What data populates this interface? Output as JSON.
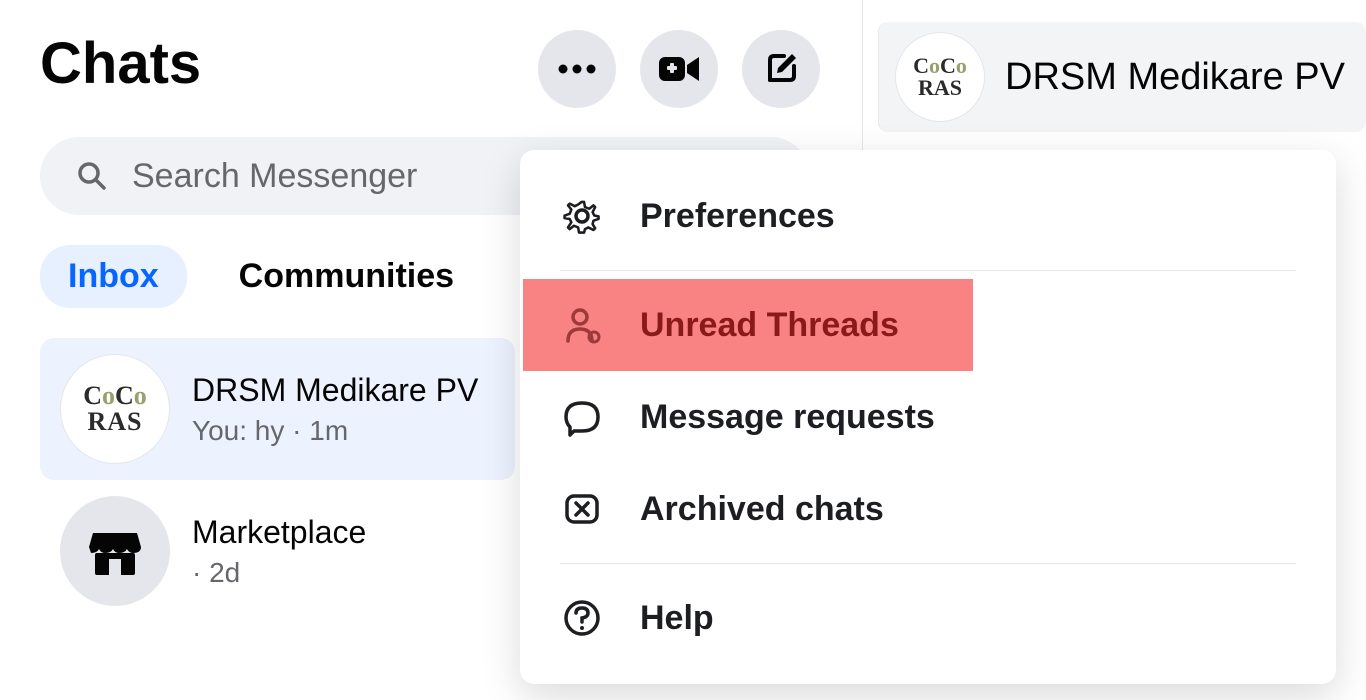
{
  "header": {
    "title": "Chats"
  },
  "search": {
    "placeholder": "Search Messenger"
  },
  "tabs": {
    "inbox": "Inbox",
    "communities": "Communities"
  },
  "chats": [
    {
      "name": "DRSM Medikare PV",
      "snippet": "You: hy · 1m",
      "avatar_text": "CoCo\nRAS"
    },
    {
      "name": "Marketplace",
      "snippet": "· 2d"
    }
  ],
  "dropdown": {
    "preferences": "Preferences",
    "unread": "Unread Threads",
    "requests": "Message requests",
    "archived": "Archived chats",
    "help": "Help"
  },
  "conversation": {
    "title": "DRSM Medikare PV",
    "avatar_text": "CoCo\nRAS"
  }
}
